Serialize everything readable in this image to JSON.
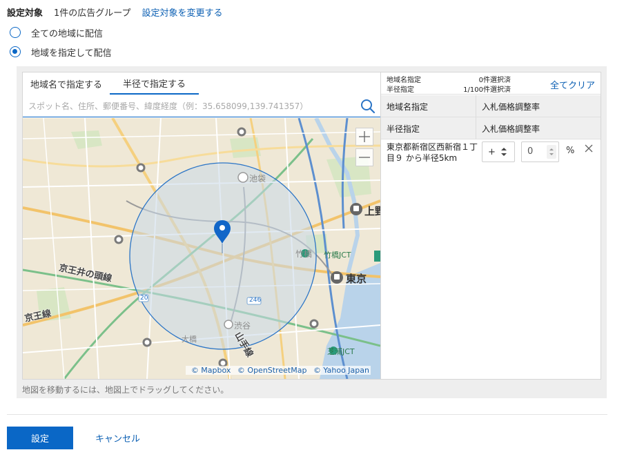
{
  "target": {
    "label": "設定対象",
    "value": "1件の広告グループ",
    "change_link": "設定対象を変更する"
  },
  "options": [
    {
      "label": "全ての地域に配信",
      "checked": false
    },
    {
      "label": "地域を指定して配信",
      "checked": true
    }
  ],
  "tabs": [
    {
      "label": "地域名で指定する",
      "active": false
    },
    {
      "label": "半径で指定する",
      "active": true
    }
  ],
  "search": {
    "placeholder": "スポット名、住所、郵便番号、緯度経度（例：35.658099,139.741357）",
    "value": ""
  },
  "map": {
    "labels": {
      "ikebukuro": "池袋",
      "ueno": "上野",
      "takebashi": "竹橋",
      "takebashi_jct": "竹橋JCT",
      "tokyo": "東京",
      "shibuya": "渋谷",
      "shibaura_jct": "芝浦JCT",
      "keio_inokashira": "京王井の頭線",
      "keio": "京王線",
      "yamanote": "山手線",
      "route246": "246",
      "route20": "20",
      "ohashi": "大橋"
    },
    "radius_km": 5,
    "attribution": [
      "© Mapbox",
      "© OpenStreetMap",
      "© Yahoo Japan"
    ],
    "hint": "地図を移動するには、地図上でドラッグしてください。"
  },
  "summary": {
    "region_label": "地域名指定",
    "region_value": "0件選択済",
    "radius_label": "半径指定",
    "radius_value": "1/100件選択済",
    "clear_all": "全てクリア"
  },
  "tables": [
    {
      "col1": "地域名指定",
      "col2": "入札価格調整率"
    },
    {
      "col1": "半径指定",
      "col2": "入札価格調整率"
    }
  ],
  "radius_rows": [
    {
      "name": "東京都新宿区西新宿１丁目９ から半径5km",
      "sign": "+",
      "value": "0",
      "unit": "%"
    }
  ],
  "footer": {
    "submit": "設定",
    "cancel": "キャンセル"
  },
  "colors": {
    "primary": "#0a67c6",
    "link": "#0b5fb3",
    "circle_fill": "#c9d8ea",
    "circle_stroke": "#2a74c6"
  }
}
